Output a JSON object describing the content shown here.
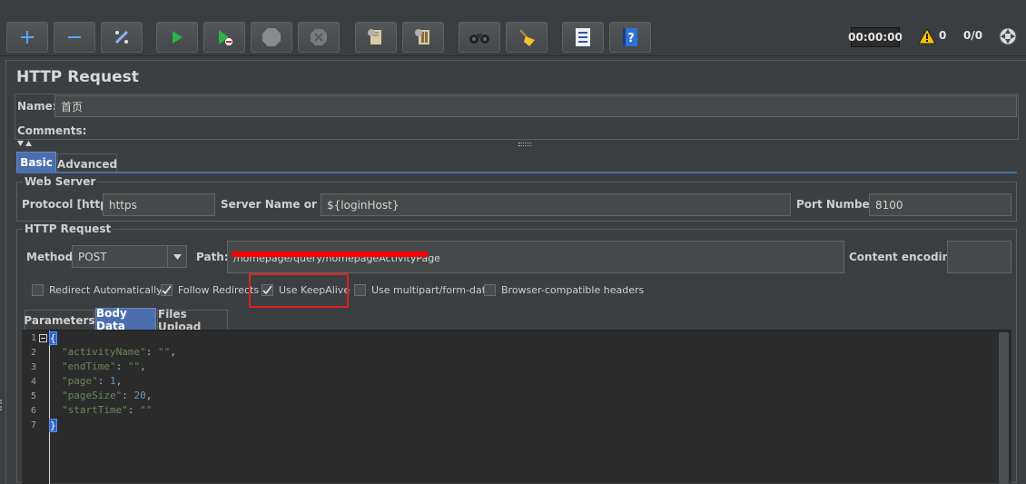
{
  "toolbar": {
    "timer": "00:00:00",
    "warning_count": "0",
    "thread_count": "0/0",
    "buttons": [
      {
        "name": "add-button",
        "icon": "plus-icon"
      },
      {
        "name": "remove-button",
        "icon": "minus-icon"
      },
      {
        "name": "toggle-button",
        "icon": "wand-icon"
      },
      {
        "name": "start-button",
        "icon": "play-icon"
      },
      {
        "name": "start-no-pauses-button",
        "icon": "play-no-timers-icon"
      },
      {
        "name": "stop-button",
        "icon": "stop-icon"
      },
      {
        "name": "shutdown-button",
        "icon": "shutdown-icon"
      },
      {
        "name": "clear-button",
        "icon": "broom-gear-icon"
      },
      {
        "name": "clear-all-button",
        "icon": "broom-gears-icon"
      },
      {
        "name": "search-button",
        "icon": "binoculars-icon"
      },
      {
        "name": "reset-search-button",
        "icon": "broom-icon"
      },
      {
        "name": "function-helper-button",
        "icon": "list-icon"
      },
      {
        "name": "help-button",
        "icon": "help-book-icon"
      }
    ]
  },
  "panel": {
    "title": "HTTP Request",
    "name_label": "Name:",
    "name_value": "首页",
    "comments_label": "Comments:"
  },
  "tabs": {
    "basic": "Basic",
    "advanced": "Advanced"
  },
  "web_server": {
    "group_title": "Web Server",
    "protocol_label": "Protocol [http]:",
    "protocol_value": "https",
    "server_label": "Server Name or IP:",
    "server_value": "${loginHost}",
    "port_label": "Port Number:",
    "port_value": "8100"
  },
  "http_request": {
    "group_title": "HTTP Request",
    "method_label": "Method:",
    "method_value": "POST",
    "path_label": "Path:",
    "path_value": "/homepage/query/homepageActivityPage",
    "encoding_label": "Content encoding:",
    "encoding_value": ""
  },
  "options": [
    {
      "label": "Redirect Automatically",
      "checked": false
    },
    {
      "label": "Follow Redirects",
      "checked": true
    },
    {
      "label": "Use KeepAlive",
      "checked": true
    },
    {
      "label": "Use multipart/form-data",
      "checked": false
    },
    {
      "label": "Browser-compatible headers",
      "checked": false
    }
  ],
  "subtabs": {
    "parameters": "Parameters",
    "body_data": "Body Data",
    "files_upload": "Files Upload"
  },
  "body": {
    "line_numbers": [
      "1",
      "2",
      "3",
      "4",
      "5",
      "6",
      "7"
    ],
    "open_brace": "{",
    "close_brace": "}",
    "l2_key": "\"activityName\"",
    "l2_sep": ": ",
    "l2_val": "\"\"",
    "l2_end": ",",
    "l3_key": "\"endTime\"",
    "l3_sep": ": ",
    "l3_val": "\"\"",
    "l3_end": ",",
    "l4_key": "\"page\"",
    "l4_sep": ": ",
    "l4_val": "1",
    "l4_end": ",",
    "l5_key": "\"pageSize\"",
    "l5_sep": ": ",
    "l5_val": "20",
    "l5_end": ",",
    "l6_key": "\"startTime\"",
    "l6_sep": ": ",
    "l6_val": "\"\""
  },
  "colors": {
    "redaction": "#ff0000",
    "highlight_box": "#e02020",
    "tab_active": "#4b6eaf"
  }
}
